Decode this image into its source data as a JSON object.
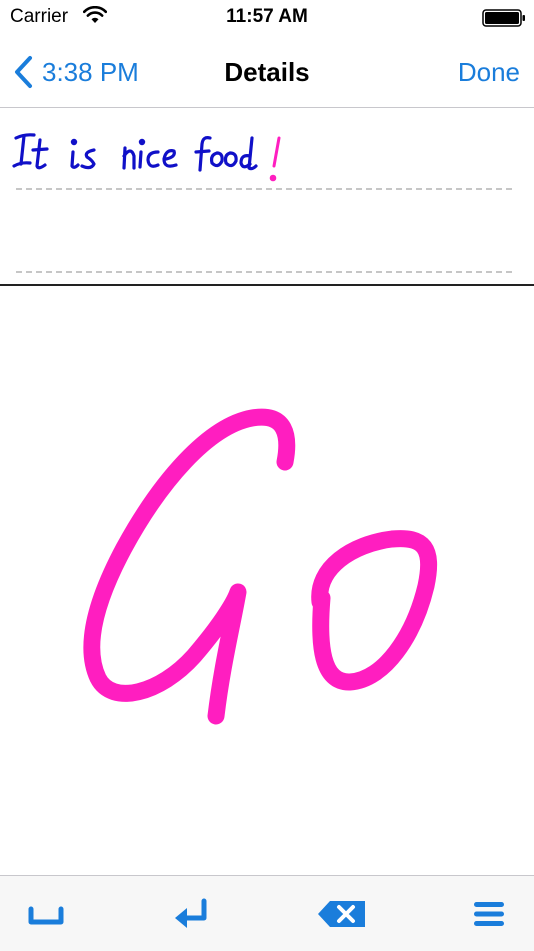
{
  "status_bar": {
    "carrier": "Carrier",
    "time": "11:57 AM"
  },
  "nav": {
    "back_label": "3:38 PM",
    "title": "Details",
    "done_label": "Done"
  },
  "colors": {
    "accent": "#1a7ddb",
    "ink_blue": "#1010c8",
    "ink_pink": "#ff1ec0"
  },
  "note": {
    "handwritten_text": "It is nice food !"
  },
  "canvas": {
    "handwritten_text": "Go"
  },
  "toolbar": {
    "items": [
      {
        "icon": "space-icon"
      },
      {
        "icon": "return-icon"
      },
      {
        "icon": "backspace-icon"
      },
      {
        "icon": "menu-icon"
      }
    ]
  }
}
